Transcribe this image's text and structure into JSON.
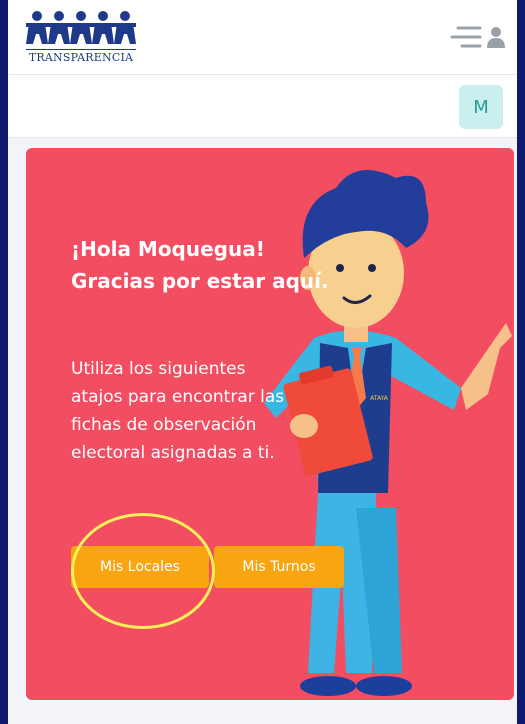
{
  "header": {
    "logo_text": "TRANSPARENCIA",
    "menu_icon": "hamburger-user-icon"
  },
  "user": {
    "avatar_initial": "M",
    "avatar_color": "#c9f0ee"
  },
  "card": {
    "background_color": "#f24d61",
    "greeting_line1": "¡Hola Moquegua!",
    "greeting_line2": "Gracias por estar aquí.",
    "intro_text": "Utiliza los siguientes atajos para encontrar las fichas de observación electoral asignadas a ti.",
    "buttons": [
      {
        "label": "Mis Locales",
        "color": "#f9a411"
      },
      {
        "label": "Mis Turnos",
        "color": "#f9a411"
      }
    ],
    "highlight_color": "#f7f05a",
    "illustration_badge": "ATAYA"
  }
}
